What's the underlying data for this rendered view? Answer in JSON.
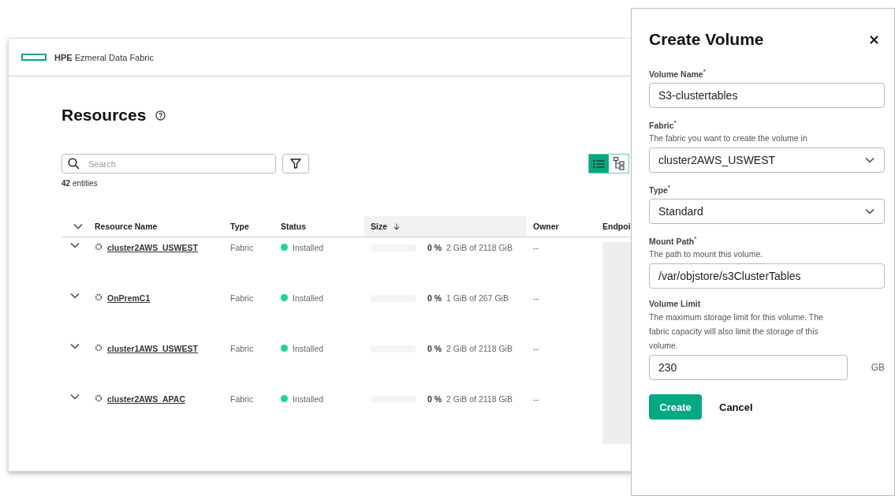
{
  "app": {
    "brand_bold": "HPE",
    "brand_rest": "Ezmeral Data Fabric"
  },
  "page": {
    "title": "Resources"
  },
  "search": {
    "placeholder": "Search"
  },
  "entity_count": "**42** entities",
  "view_toggle": [
    {
      "kind": "list",
      "selected": true
    },
    {
      "kind": "tree",
      "selected": false
    }
  ],
  "table": {
    "columns": [
      {
        "label": "Resource Name",
        "sorted": false
      },
      {
        "label": "Type",
        "sorted": false
      },
      {
        "label": "Status",
        "sorted": false
      },
      {
        "label": "Size",
        "sorted": true
      },
      {
        "label": "Owner",
        "sorted": false
      },
      {
        "label": "Endpoi",
        "sorted": false
      }
    ],
    "rows": [
      {
        "name": "cluster2AWS_USWEST",
        "type": "Fabric",
        "status": "Installed",
        "level": 0,
        "percent": "0 %",
        "usage": "2 GiB of 2118 GiB",
        "owner": "--"
      },
      {
        "name": "OnPremC1",
        "type": "Fabric",
        "status": "Installed",
        "level": 0,
        "percent": "0 %",
        "usage": "1 GiB of 267 GiB",
        "owner": "--"
      },
      {
        "name": "cluster1AWS_USWEST",
        "type": "Fabric",
        "status": "Installed",
        "level": 0,
        "percent": "0 %",
        "usage": "2 GiB of 2118 GiB",
        "owner": "--"
      },
      {
        "name": "cluster2AWS_APAC",
        "type": "Fabric",
        "status": "Installed",
        "level": 0,
        "percent": "0 %",
        "usage": "2 GiB of 2118 GiB",
        "owner": "--"
      }
    ]
  },
  "dialog": {
    "title": "Create Volume",
    "fields": [
      {
        "kind": "input",
        "label": "Volume Name$^{*}$",
        "value": "S3-clustertables"
      },
      {
        "kind": "select",
        "label": "Fabric$^{*}$",
        "help": "The fabric you want to create the volume in",
        "value": "cluster2AWS_USWEST"
      },
      {
        "kind": "select",
        "label": "Type$^{*}$",
        "value": "Standard"
      },
      {
        "kind": "input",
        "label": "Mount Path$^{*}$",
        "help": "The path to mount this volume.",
        "value": "/var/objstore/s3ClusterTables"
      },
      {
        "kind": "input",
        "label": "Volume Limit",
        "help": "The maximum storage limit for this volume. The fabric capacity will also limit the storage of this volume.",
        "value": "230",
        "unit": "GB"
      }
    ],
    "buttons": [
      {
        "label": "Create",
        "kind": "primary"
      },
      {
        "label": "Cancel",
        "kind": "plain"
      }
    ]
  }
}
